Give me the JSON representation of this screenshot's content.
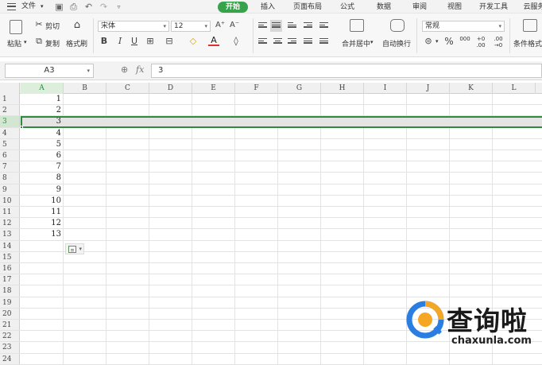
{
  "menubar": {
    "file_label": "文件",
    "tabs": [
      {
        "label": "开始",
        "active": true
      },
      {
        "label": "插入",
        "active": false
      },
      {
        "label": "页面布局",
        "active": false
      },
      {
        "label": "公式",
        "active": false
      },
      {
        "label": "数据",
        "active": false
      },
      {
        "label": "审阅",
        "active": false
      },
      {
        "label": "视图",
        "active": false
      },
      {
        "label": "开发工具",
        "active": false
      },
      {
        "label": "云服务",
        "active": false
      }
    ],
    "accent_color": "#36a24a"
  },
  "ribbon": {
    "clipboard": {
      "paste_label": "粘贴",
      "cut_label": "剪切",
      "copy_label": "复制",
      "format_painter_label": "格式刷"
    },
    "font": {
      "font_name": "宋体",
      "font_size": "12",
      "grow_icon": "A⁺",
      "shrink_icon": "A⁻",
      "bold": "B",
      "italic": "I",
      "underline": "U",
      "font_color_glyph": "A"
    },
    "alignment": {
      "merge_label": "合并居中",
      "wrap_label": "自动换行"
    },
    "number": {
      "format": "常规",
      "percent": "%",
      "thousands": "000",
      "inc_decimal": "+0 .00",
      "dec_decimal": ".00 →0"
    },
    "conditional_label": "条件格式"
  },
  "formula_bar": {
    "name_box": "A3",
    "fx": "fx",
    "value": "3"
  },
  "grid": {
    "columns": [
      "A",
      "B",
      "C",
      "D",
      "E",
      "F",
      "G",
      "H",
      "I",
      "J",
      "K",
      "L"
    ],
    "row_numbers": [
      "1",
      "2",
      "3",
      "4",
      "5",
      "6",
      "7",
      "8",
      "9",
      "10",
      "11",
      "12",
      "13",
      "14",
      "15",
      "16",
      "17",
      "18",
      "19",
      "20",
      "21",
      "22",
      "23",
      "24"
    ],
    "column_a_values": [
      "1",
      "2",
      "3",
      "4",
      "5",
      "6",
      "7",
      "8",
      "9",
      "10",
      "11",
      "12",
      "13"
    ],
    "selected_row": "3",
    "selection_color": "#2e8b3e"
  },
  "watermark": {
    "chinese": "查询啦",
    "latin": "chaxunla.com",
    "logo_colors": [
      "#2a7de1",
      "#f5a623"
    ]
  }
}
